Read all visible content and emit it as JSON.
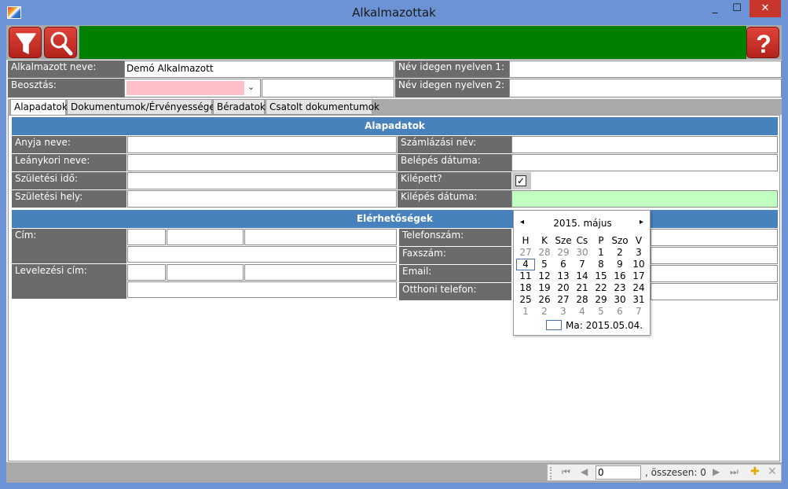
{
  "window": {
    "title": "Alkalmazottak",
    "min_glyph": "_",
    "max_glyph": "☐",
    "close_glyph": "✕"
  },
  "toolbar": {
    "filter_icon": "filter-funnel-icon",
    "search_icon": "magnifier-icon",
    "help_icon": "question-mark-icon",
    "accent_green": "#008000",
    "button_red": "#d33a30"
  },
  "header": {
    "name_label": "Alkalmazott neve:",
    "name_value": "Demó Alkalmazott",
    "position_label": "Beosztás:",
    "position_value": "",
    "position_extra": "",
    "foreign1_label": "Név idegen nyelven 1:",
    "foreign1_value": "",
    "foreign2_label": "Név idegen nyelven 2:",
    "foreign2_value": ""
  },
  "tabs": [
    {
      "label": "Alapadatok",
      "active": true
    },
    {
      "label": "Dokumentumok/Érvényességek",
      "active": false
    },
    {
      "label": "Béradatok",
      "active": false
    },
    {
      "label": "Csatolt dokumentumok",
      "active": false
    }
  ],
  "basic": {
    "section_title": "Alapadatok",
    "mother_name_label": "Anyja neve:",
    "maiden_name_label": "Leánykori neve:",
    "birth_date_label": "Születési idő:",
    "birth_place_label": "Születési hely:",
    "billing_name_label": "Számlázási név:",
    "entry_date_label": "Belépés dátuma:",
    "left_label": "Kilépett?",
    "left_checked": true,
    "exit_date_label": "Kilépés dátuma:"
  },
  "contact": {
    "section_title": "Elérhetőségek",
    "address_label": "Cím:",
    "mail_address_label": "Levelezési cím:",
    "phone_label": "Telefonszám:",
    "fax_label": "Faxszám:",
    "email_label": "Email:",
    "home_phone_label": "Otthoni telefon:"
  },
  "calendar": {
    "title": "2015. május",
    "prev_glyph": "◂",
    "next_glyph": "▸",
    "weekdays": [
      "H",
      "K",
      "Sze",
      "Cs",
      "P",
      "Szo",
      "V"
    ],
    "weeks": [
      [
        {
          "d": "27",
          "o": true
        },
        {
          "d": "28",
          "o": true
        },
        {
          "d": "29",
          "o": true
        },
        {
          "d": "30",
          "o": true
        },
        {
          "d": "1",
          "o": false
        },
        {
          "d": "2",
          "o": false
        },
        {
          "d": "3",
          "o": false
        }
      ],
      [
        {
          "d": "4",
          "o": false,
          "today": true
        },
        {
          "d": "5",
          "o": false
        },
        {
          "d": "6",
          "o": false
        },
        {
          "d": "7",
          "o": false
        },
        {
          "d": "8",
          "o": false
        },
        {
          "d": "9",
          "o": false
        },
        {
          "d": "10",
          "o": false
        }
      ],
      [
        {
          "d": "11",
          "o": false
        },
        {
          "d": "12",
          "o": false
        },
        {
          "d": "13",
          "o": false
        },
        {
          "d": "14",
          "o": false
        },
        {
          "d": "15",
          "o": false
        },
        {
          "d": "16",
          "o": false
        },
        {
          "d": "17",
          "o": false
        }
      ],
      [
        {
          "d": "18",
          "o": false
        },
        {
          "d": "19",
          "o": false
        },
        {
          "d": "20",
          "o": false
        },
        {
          "d": "21",
          "o": false
        },
        {
          "d": "22",
          "o": false
        },
        {
          "d": "23",
          "o": false
        },
        {
          "d": "24",
          "o": false
        }
      ],
      [
        {
          "d": "25",
          "o": false
        },
        {
          "d": "26",
          "o": false
        },
        {
          "d": "27",
          "o": false
        },
        {
          "d": "28",
          "o": false
        },
        {
          "d": "29",
          "o": false
        },
        {
          "d": "30",
          "o": false
        },
        {
          "d": "31",
          "o": false
        }
      ],
      [
        {
          "d": "1",
          "o": true
        },
        {
          "d": "2",
          "o": true
        },
        {
          "d": "3",
          "o": true
        },
        {
          "d": "4",
          "o": true
        },
        {
          "d": "5",
          "o": true
        },
        {
          "d": "6",
          "o": true
        },
        {
          "d": "7",
          "o": true
        }
      ]
    ],
    "today_text": "Ma: 2015.05.04."
  },
  "navigator": {
    "first_glyph": "⏮",
    "prev_glyph": "◀",
    "page_value": "0",
    "count_text": ", összesen: 0",
    "next_glyph": "▶",
    "last_glyph": "⏭",
    "add_glyph": "✚",
    "delete_glyph": "✕"
  }
}
